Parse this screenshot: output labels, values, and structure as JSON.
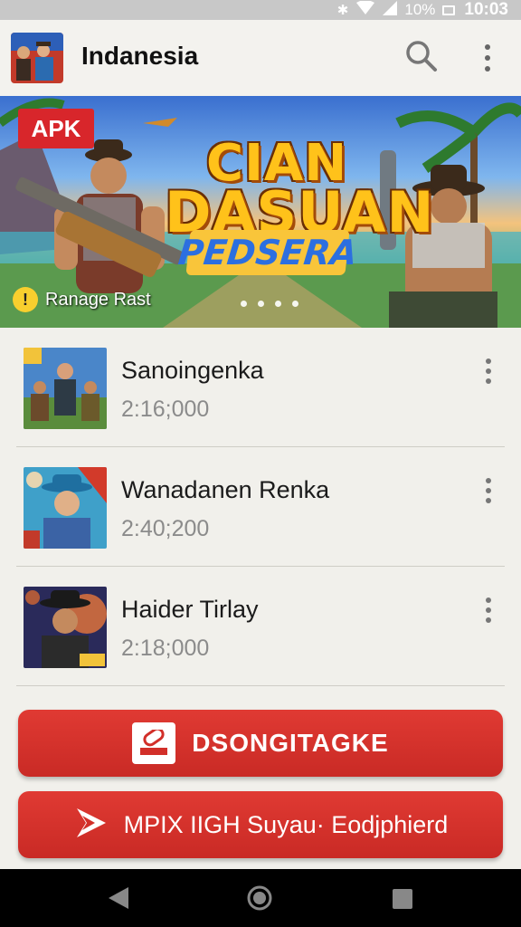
{
  "status_bar": {
    "battery": "10%",
    "time": "10:03"
  },
  "app_bar": {
    "title": "Indanesia",
    "icons": [
      "app-avatar",
      "search-icon",
      "more-vert-icon"
    ]
  },
  "banner": {
    "badge": "APK",
    "title_line1": "CIAN",
    "title_line2": "DASUAN",
    "title_line3": "PEDSERA",
    "caption": "Ranage Rast",
    "caption_icon": "!",
    "page_count": 4
  },
  "list": {
    "items": [
      {
        "title": "Sanoingenka",
        "subtitle": "2:16;000"
      },
      {
        "title": "Wanadanen Renka",
        "subtitle": "2:40;200"
      },
      {
        "title": "Haider Tirlay",
        "subtitle": "2:18;000"
      }
    ]
  },
  "buttons": {
    "primary_label": "DSONGITAGKE",
    "secondary_label": "MPIX IIGH Suyau· Eodjphierd"
  },
  "colors": {
    "accent_red": "#d22f29",
    "background": "#f1f0eb",
    "subtitle_gray": "#8b8b8b"
  }
}
